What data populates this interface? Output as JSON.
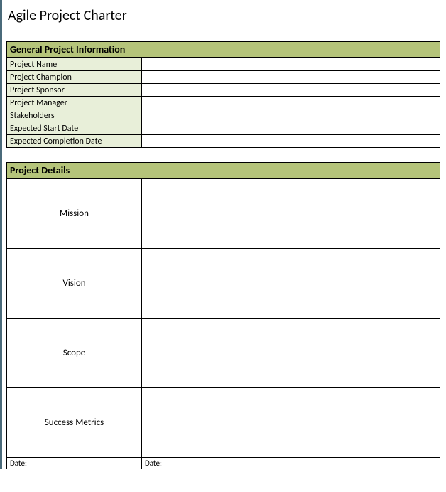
{
  "title": "Agile Project Charter",
  "sections": {
    "general": {
      "header": "General Project Information",
      "rows": [
        {
          "label": "Project Name",
          "value": ""
        },
        {
          "label": "Project Champion",
          "value": ""
        },
        {
          "label": "Project Sponsor",
          "value": ""
        },
        {
          "label": "Project Manager",
          "value": ""
        },
        {
          "label": "Stakeholders",
          "value": ""
        },
        {
          "label": "Expected Start Date",
          "value": ""
        },
        {
          "label": "Expected Completion Date",
          "value": ""
        }
      ]
    },
    "details": {
      "header": "Project Details",
      "rows": [
        {
          "label": "Mission",
          "value": ""
        },
        {
          "label": "Vision",
          "value": ""
        },
        {
          "label": "Scope",
          "value": ""
        },
        {
          "label": "Success Metrics",
          "value": ""
        }
      ]
    },
    "footer": {
      "date1_label": "Date:",
      "date1_value": "",
      "date2_label": "Date:",
      "date2_value": ""
    }
  }
}
